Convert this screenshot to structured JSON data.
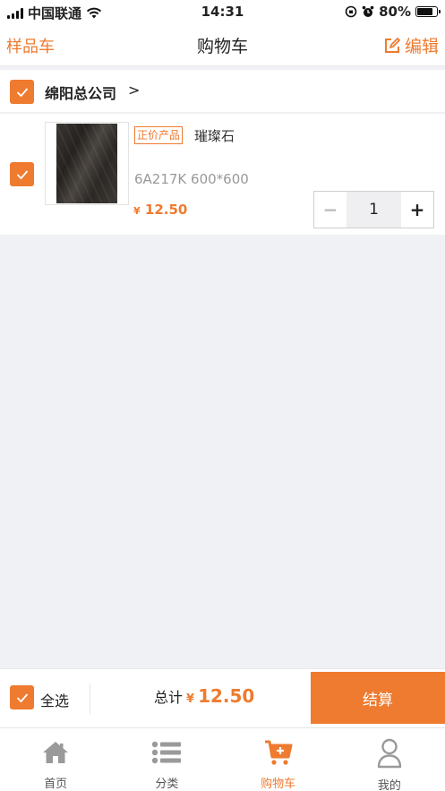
{
  "status_bar": {
    "carrier": "中国联通",
    "time": "14:31",
    "battery": "80%",
    "battery_level": 0.8
  },
  "nav": {
    "left": "样品车",
    "title": "购物车",
    "right": "编辑"
  },
  "store": {
    "name": "绵阳总公司",
    "chevron": ">"
  },
  "product": {
    "tag": "正价产品",
    "name": "璀璨石",
    "spec": "6A217K   600*600",
    "currency": "¥",
    "price": "12.50",
    "quantity": "1"
  },
  "stepper": {
    "minus": "−",
    "plus": "+"
  },
  "checkout": {
    "select_all": "全选",
    "total_label": "总计",
    "currency": "¥",
    "total": "12.50",
    "button": "结算"
  },
  "tabs": [
    {
      "label": "首页",
      "icon": "home-icon",
      "active": false
    },
    {
      "label": "分类",
      "icon": "list-icon",
      "active": false
    },
    {
      "label": "购物车",
      "icon": "cart-icon",
      "active": true
    },
    {
      "label": "我的",
      "icon": "user-icon",
      "active": false
    }
  ],
  "colors": {
    "accent": "#ee7b2f",
    "background": "#f0f1f5",
    "tab_inactive": "#9a9a9a"
  }
}
